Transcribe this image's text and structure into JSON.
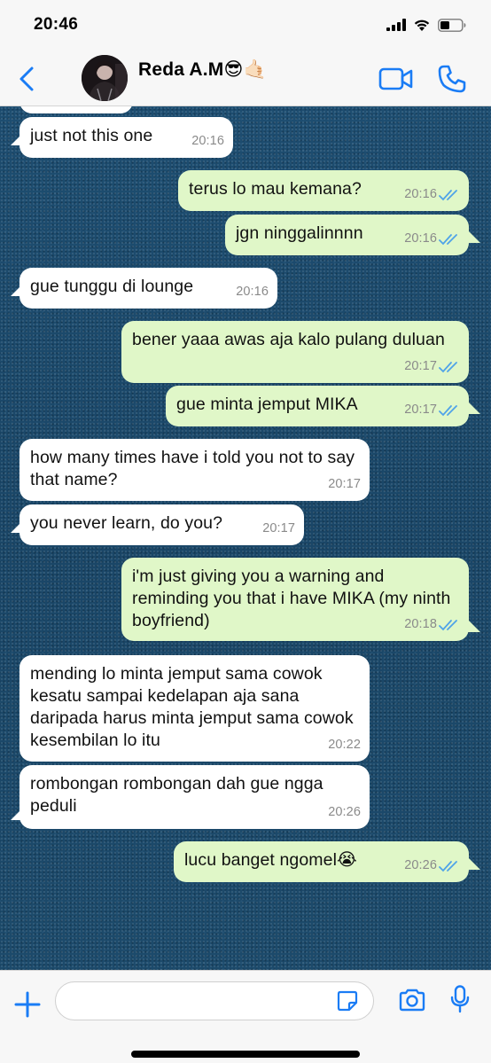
{
  "status_bar": {
    "time": "20:46",
    "icons": [
      "signal-icon",
      "wifi-icon",
      "battery-icon"
    ]
  },
  "header": {
    "contact_name": "Reda A.M😎🤙🏻",
    "icons": [
      "back-chevron-icon",
      "avatar",
      "video-camera-icon",
      "phone-icon"
    ],
    "accent_color": "#1a7cf5"
  },
  "messages": [
    {
      "dir": "in",
      "text": "just not this one",
      "time": "20:16"
    },
    {
      "dir": "out",
      "text": "terus lo mau kemana?",
      "time": "20:16",
      "read": true
    },
    {
      "dir": "out",
      "text": "jgn ninggalinnnn",
      "time": "20:16",
      "read": true
    },
    {
      "dir": "in",
      "text": "gue tunggu di lounge",
      "time": "20:16"
    },
    {
      "dir": "out",
      "text": "bener yaaa awas aja kalo pulang duluan",
      "time": "20:17",
      "read": true
    },
    {
      "dir": "out",
      "text": "gue minta jemput MIKA",
      "time": "20:17",
      "read": true
    },
    {
      "dir": "in",
      "text": "how many times have i told you not to say that name?",
      "time": "20:17"
    },
    {
      "dir": "in",
      "text": "you never learn, do you?",
      "time": "20:17"
    },
    {
      "dir": "out",
      "text": "i'm just giving you a warning and reminding you that i have MIKA (my ninth boyfriend)",
      "time": "20:18",
      "read": true
    },
    {
      "dir": "in",
      "text": "mending lo minta jemput sama cowok kesatu sampai kedelapan aja sana daripada harus minta jemput sama cowok kesembilan lo itu",
      "time": "20:22"
    },
    {
      "dir": "in",
      "text": "rombongan rombongan dah gue ngga peduli",
      "time": "20:26"
    },
    {
      "dir": "out",
      "text": "lucu banget ngomel😭",
      "time": "20:26",
      "read": true
    }
  ],
  "input_bar": {
    "placeholder": "",
    "icons": [
      "plus-icon",
      "sticker-icon",
      "camera-icon",
      "microphone-icon"
    ]
  },
  "colors": {
    "incoming_bubble": "#ffffff",
    "outgoing_bubble": "#e0f7c8",
    "read_ticks": "#4fa3e8",
    "chat_background": "#1c4a6b"
  }
}
